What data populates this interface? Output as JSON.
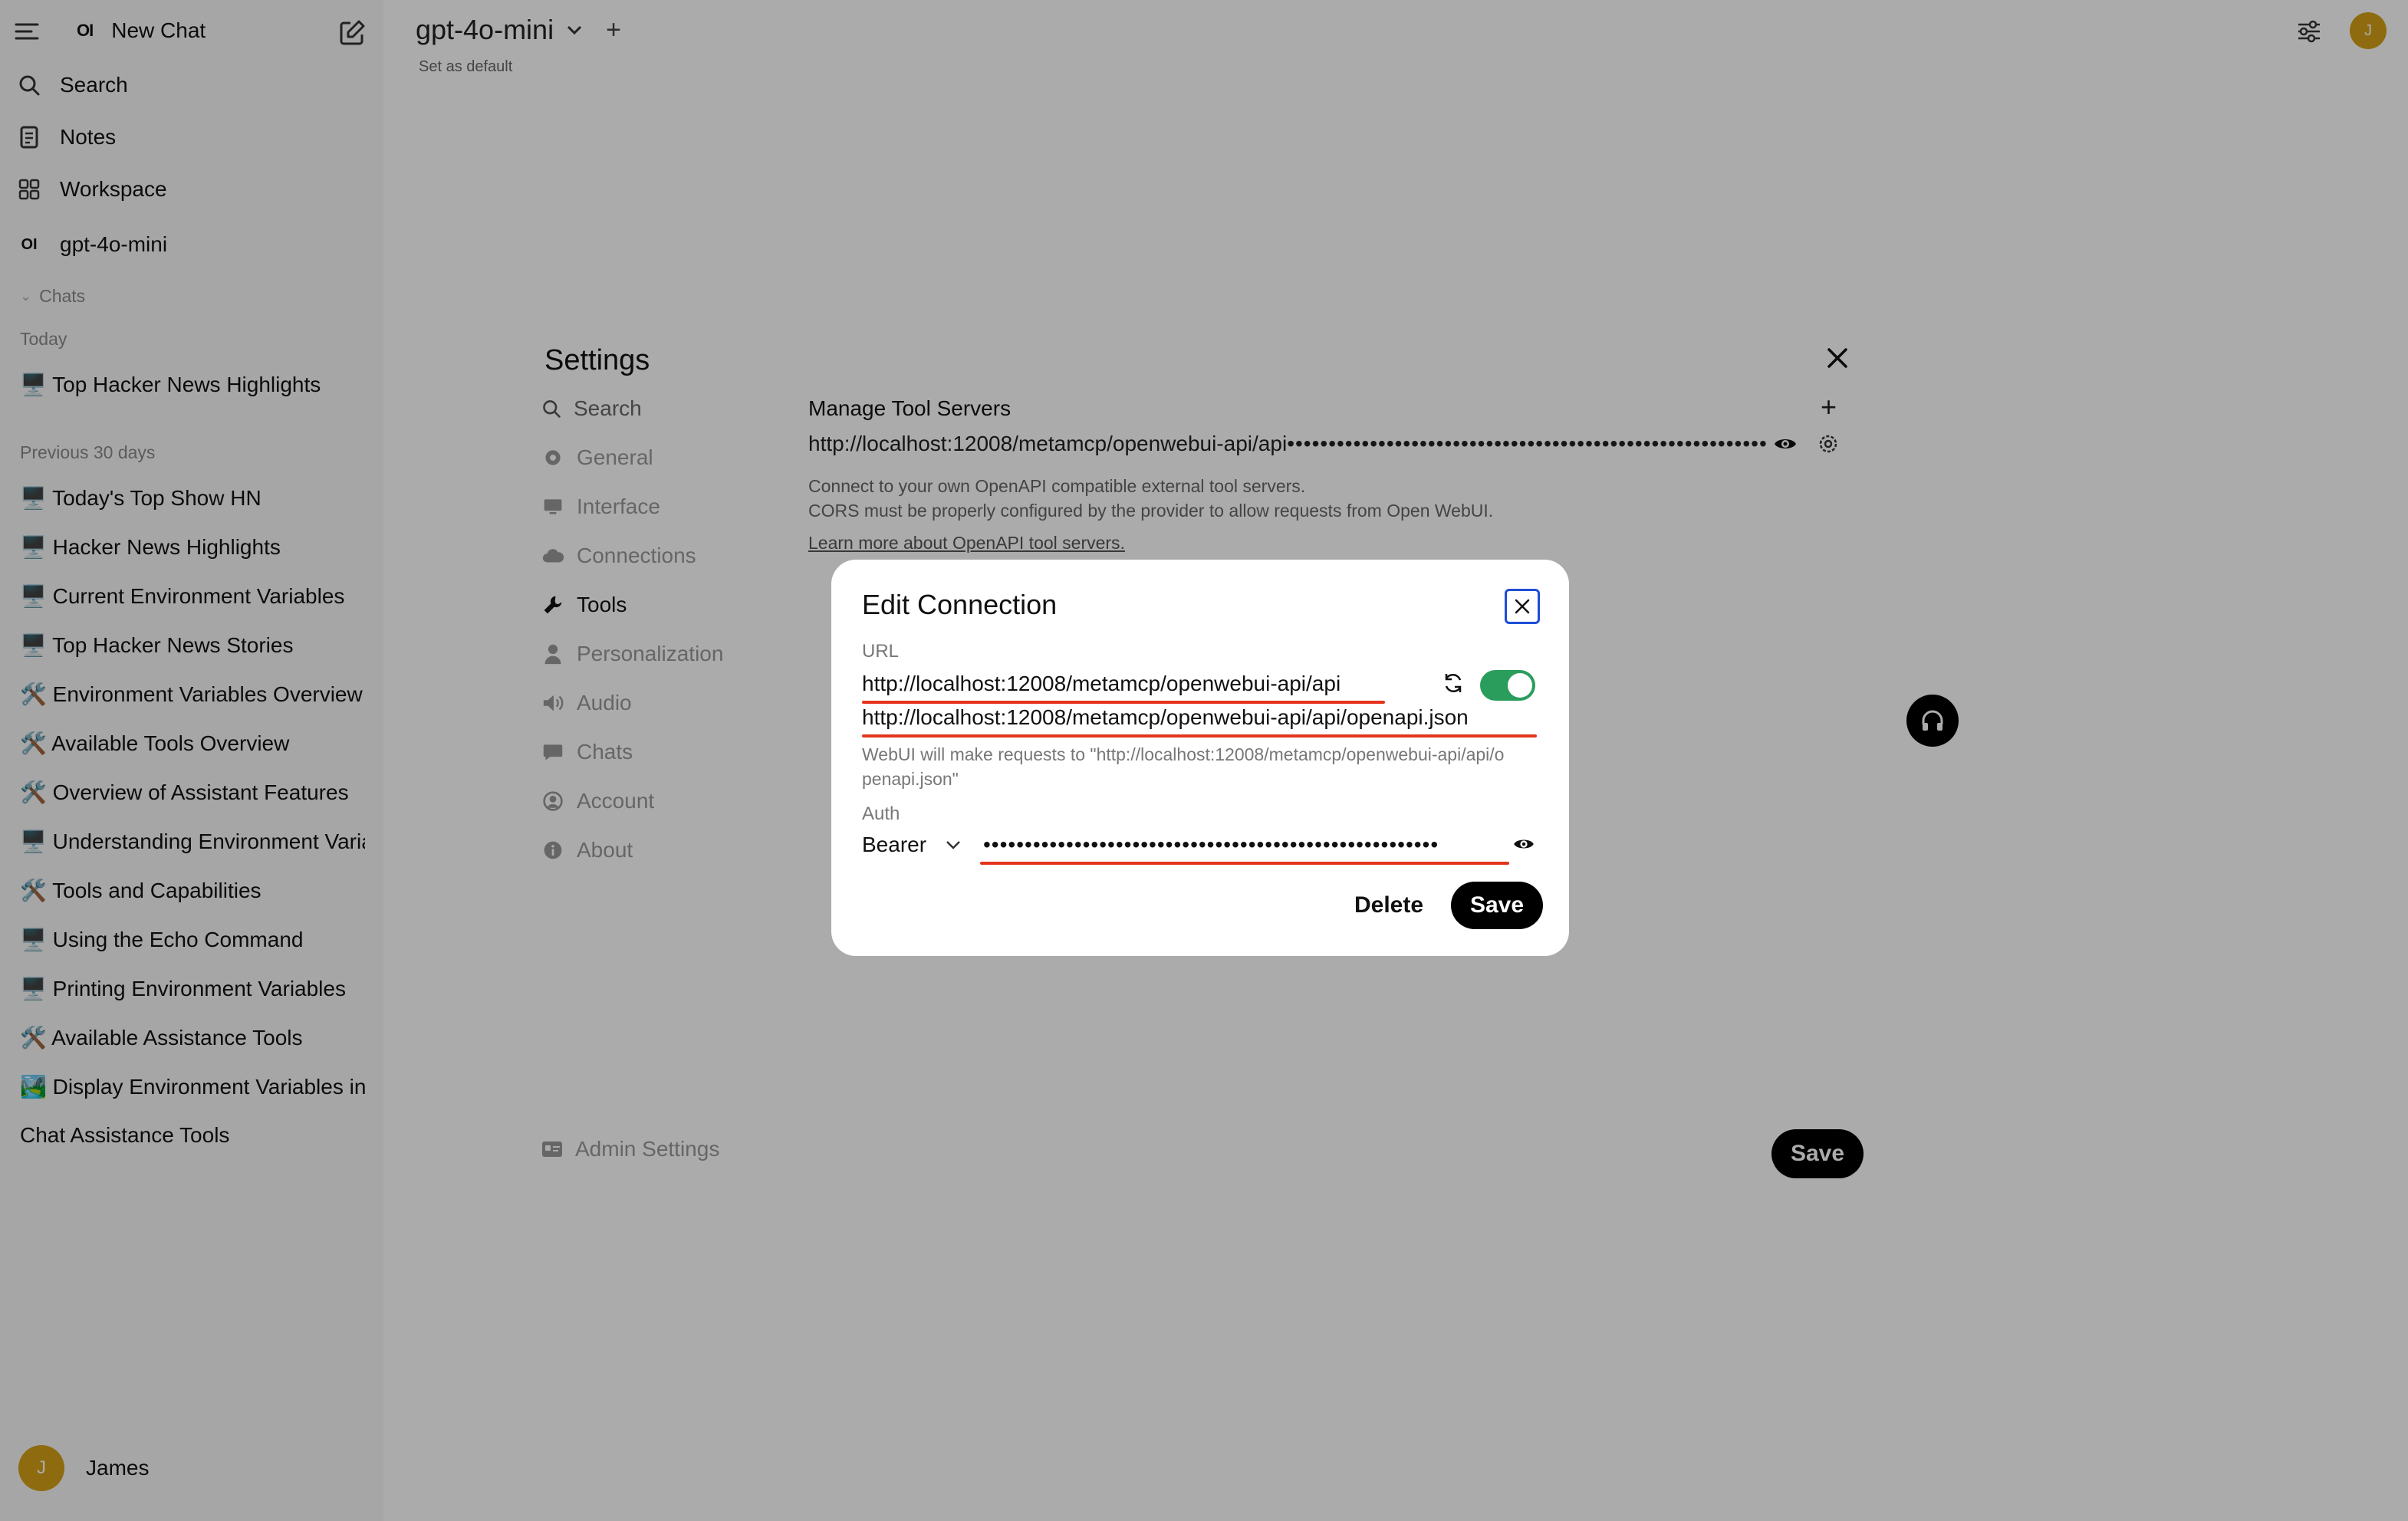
{
  "sidebar": {
    "new_chat": "New Chat",
    "nav": [
      {
        "label": "Search",
        "icon": "search-icon"
      },
      {
        "label": "Notes",
        "icon": "notes-icon"
      },
      {
        "label": "Workspace",
        "icon": "workspace-icon"
      },
      {
        "label": "gpt-4o-mini",
        "icon": "model-logo-icon"
      }
    ],
    "chats_header": "Chats",
    "group_today": "Today",
    "today_chats": [
      "🖥️ Top Hacker News Highlights"
    ],
    "group_previous": "Previous 30 days",
    "previous_chats": [
      "🖥️ Today's Top Show HN",
      "🖥️ Hacker News Highlights",
      "🖥️ Current Environment Variables",
      "🖥️ Top Hacker News Stories",
      "🛠️ Environment Variables Overview",
      "🛠️ Available Tools Overview",
      "🛠️ Overview of Assistant Features",
      "🖥️ Understanding Environment Variables",
      "🛠️ Tools and Capabilities",
      "🖥️ Using the Echo Command",
      "🖥️ Printing Environment Variables",
      "🛠️ Available Assistance Tools",
      "🏞️ Display Environment Variables in",
      "Chat Assistance Tools"
    ],
    "user_name": "James",
    "avatar_initial": "J"
  },
  "header": {
    "model_name": "gpt-4o-mini",
    "set_default": "Set as default",
    "avatar_initial": "J"
  },
  "settings": {
    "title": "Settings",
    "search_placeholder": "Search",
    "nav": [
      {
        "label": "General",
        "icon": "gear-icon"
      },
      {
        "label": "Interface",
        "icon": "monitor-icon"
      },
      {
        "label": "Connections",
        "icon": "cloud-icon"
      },
      {
        "label": "Tools",
        "icon": "wrench-icon",
        "active": true
      },
      {
        "label": "Personalization",
        "icon": "person-icon"
      },
      {
        "label": "Audio",
        "icon": "speaker-icon"
      },
      {
        "label": "Chats",
        "icon": "chat-bubble-icon"
      },
      {
        "label": "Account",
        "icon": "account-icon"
      },
      {
        "label": "About",
        "icon": "info-icon"
      }
    ],
    "admin_settings": "Admin Settings",
    "manage_tool_servers": "Manage Tool Servers",
    "server_url": "http://localhost:12008/metamcp/openwebui-api/api",
    "server_key_mask": "••••••••••••••••••••••••••••••••••••••••••••••••••••••••••••",
    "desc_line1": "Connect to your own OpenAPI compatible external tool servers.",
    "desc_line2": "CORS must be properly configured by the provider to allow requests from Open WebUI.",
    "learn_more": "Learn more about OpenAPI tool servers.",
    "save_label": "Save"
  },
  "dialog": {
    "title": "Edit Connection",
    "url_label": "URL",
    "url_value": "http://localhost:12008/metamcp/openwebui-api/api",
    "enabled": true,
    "openapi_path": "http://localhost:12008/metamcp/openwebui-api/api/openapi.json",
    "helper_text": "WebUI will make requests to \"http://localhost:12008/metamcp/openwebui-api/api/openapi.json\"",
    "auth_label": "Auth",
    "auth_type": "Bearer",
    "auth_key_mask": "•••••••••••••••••••••••••••••••••••••••••••••••••••••••",
    "delete_label": "Delete",
    "save_label": "Save"
  },
  "colors": {
    "accent_green": "#2a9d5c",
    "annotation_red": "#e5331b",
    "focus_blue": "#1d4ed8"
  }
}
